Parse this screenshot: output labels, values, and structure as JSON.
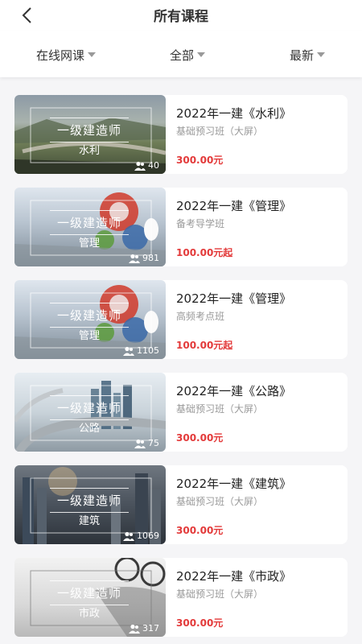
{
  "header": {
    "title": "所有课程"
  },
  "filters": [
    {
      "label": "在线网课"
    },
    {
      "label": "全部"
    },
    {
      "label": "最新"
    }
  ],
  "courses": [
    {
      "badge": "一级建造师",
      "subject": "水利",
      "views": "40",
      "title": "2022年一建《水利》",
      "subtitle": "基础预习班（大屏）",
      "price": "300.00元",
      "theme": "dam"
    },
    {
      "badge": "一级建造师",
      "subject": "管理",
      "views": "981",
      "title": "2022年一建《管理》",
      "subtitle": "备考导学班",
      "price": "100.00元起",
      "theme": "gears"
    },
    {
      "badge": "一级建造师",
      "subject": "管理",
      "views": "1105",
      "title": "2022年一建《管理》",
      "subtitle": "高频考点班",
      "price": "100.00元起",
      "theme": "gears"
    },
    {
      "badge": "一级建造师",
      "subject": "公路",
      "views": "75",
      "title": "2022年一建《公路》",
      "subtitle": "基础预习班（大屏）",
      "price": "300.00元",
      "theme": "road"
    },
    {
      "badge": "一级建造师",
      "subject": "建筑",
      "views": "1069",
      "title": "2022年一建《建筑》",
      "subtitle": "基础预习班（大屏）",
      "price": "300.00元",
      "theme": "city"
    },
    {
      "badge": "一级建造师",
      "subject": "市政",
      "views": "317",
      "title": "2022年一建《市政》",
      "subtitle": "基础预习班（大屏）",
      "price": "300.00元",
      "theme": "glasses"
    }
  ],
  "colors": {
    "price": "#e33a3a",
    "subtitle": "#999999",
    "background": "#f5f5f7"
  },
  "icons": {
    "back": "chevron-left-icon",
    "dropdown": "caret-down-icon",
    "views": "users-icon"
  }
}
